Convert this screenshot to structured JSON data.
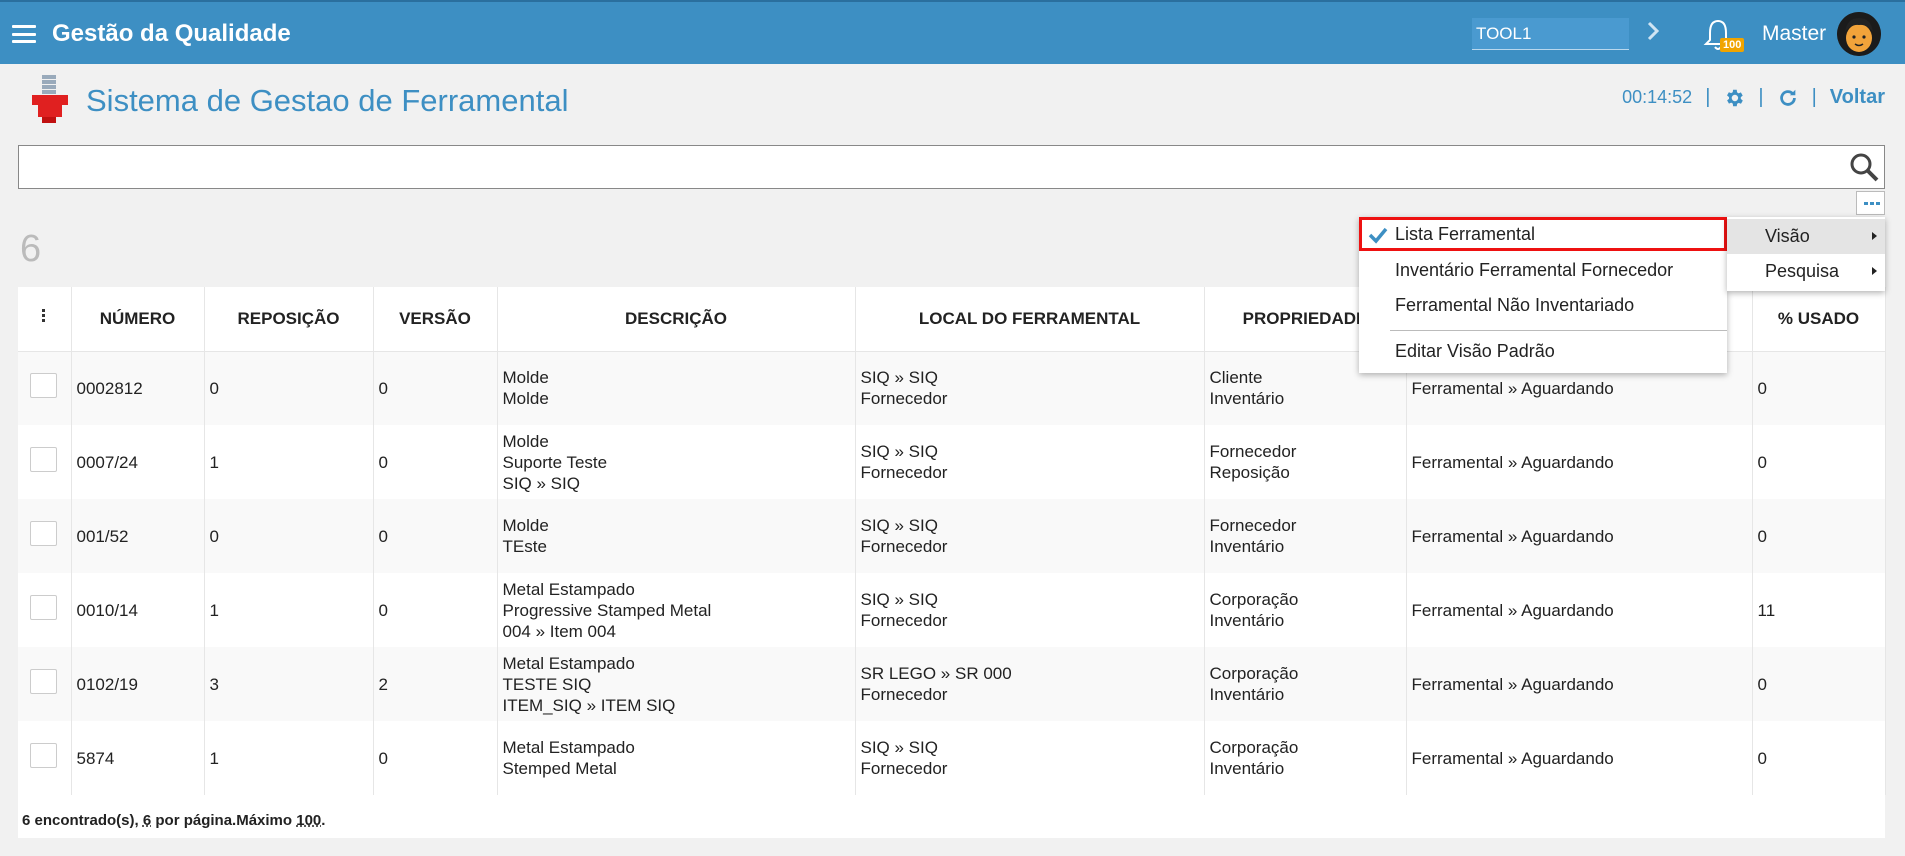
{
  "topbar": {
    "app_title": "Gestão da Qualidade",
    "tool_value": "TOOL1",
    "notification_count": "100",
    "user_name": "Master",
    "bar_color": "#3d8fc3"
  },
  "header": {
    "page_title": "Sistema de Gestao de Ferramental",
    "clock": "00:14:52",
    "back_label": "Voltar",
    "icons": [
      "gear-icon",
      "refresh-icon"
    ]
  },
  "search": {
    "value": "",
    "placeholder": ""
  },
  "record_count": "6",
  "table": {
    "columns": [
      "NÚMERO",
      "REPOSIÇÃO",
      "VERSÃO",
      "DESCRIÇÃO",
      "LOCAL DO FERRAMENTAL",
      "PROPRIEDADE",
      "",
      "% USADO"
    ],
    "rows": [
      {
        "numero": "0002812",
        "reposicao": "0",
        "versao": "0",
        "descricao": [
          "Molde",
          "Molde"
        ],
        "local": [
          "SIQ » SIQ",
          "Fornecedor"
        ],
        "propriedade": [
          "Cliente",
          "Inventário"
        ],
        "status": "Ferramental » Aguardando",
        "usado": "0"
      },
      {
        "numero": "0007/24",
        "reposicao": "1",
        "versao": "0",
        "descricao": [
          "Molde",
          "Suporte Teste",
          "SIQ » SIQ"
        ],
        "local": [
          "SIQ » SIQ",
          "Fornecedor"
        ],
        "propriedade": [
          "Fornecedor",
          "Reposição"
        ],
        "status": "Ferramental » Aguardando",
        "usado": "0"
      },
      {
        "numero": "001/52",
        "reposicao": "0",
        "versao": "0",
        "descricao": [
          "Molde",
          "TEste"
        ],
        "local": [
          "SIQ » SIQ",
          "Fornecedor"
        ],
        "propriedade": [
          "Fornecedor",
          "Inventário"
        ],
        "status": "Ferramental » Aguardando",
        "usado": "0"
      },
      {
        "numero": "0010/14",
        "reposicao": "1",
        "versao": "0",
        "descricao": [
          "Metal Estampado",
          "Progressive Stamped Metal",
          "004 » Item 004"
        ],
        "local": [
          "SIQ » SIQ",
          "Fornecedor"
        ],
        "propriedade": [
          "Corporação",
          "Inventário"
        ],
        "status": "Ferramental » Aguardando",
        "usado": "11"
      },
      {
        "numero": "0102/19",
        "reposicao": "3",
        "versao": "2",
        "descricao": [
          "Metal Estampado",
          "TESTE SIQ",
          "ITEM_SIQ » ITEM SIQ"
        ],
        "local": [
          "SR LEGO » SR 000",
          "Fornecedor"
        ],
        "propriedade": [
          "Corporação",
          "Inventário"
        ],
        "status": "Ferramental » Aguardando",
        "usado": "0"
      },
      {
        "numero": "5874",
        "reposicao": "1",
        "versao": "0",
        "descricao": [
          "Metal Estampado",
          "Stemped Metal"
        ],
        "local": [
          "SIQ » SIQ",
          "Fornecedor"
        ],
        "propriedade": [
          "Corporação",
          "Inventário"
        ],
        "status": "Ferramental » Aguardando",
        "usado": "0"
      }
    ]
  },
  "footer": {
    "found_text": "6 encontrado(s), ",
    "per_page_num": "6",
    "per_page_text": " por página.Máximo ",
    "max_num": "100",
    "end": "."
  },
  "menu": {
    "items": [
      "Lista Ferramental",
      "Inventário Ferramental Fornecedor",
      "Ferramental Não Inventariado",
      "Editar Visão Padrão"
    ],
    "selected_index": 0,
    "submenu": [
      "Visão",
      "Pesquisa"
    ],
    "highlight_color": "#ee1111"
  }
}
